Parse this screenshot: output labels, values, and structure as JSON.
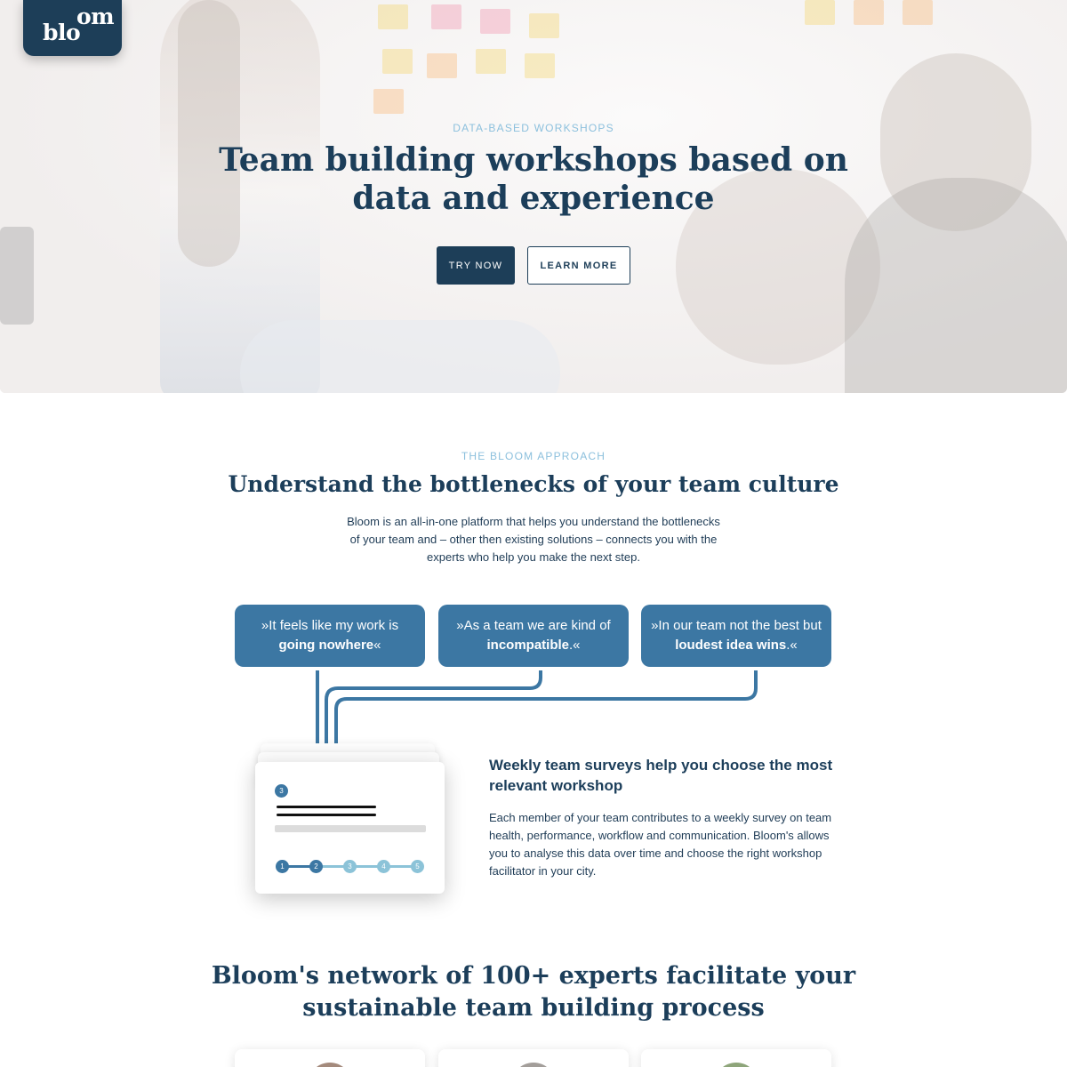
{
  "brand": {
    "logo_top": "om",
    "logo_bottom": "blo"
  },
  "hero": {
    "eyebrow": "DATA-BASED WORKSHOPS",
    "title": "Team building workshops based on data and experience",
    "try_label": "TRY NOW",
    "learn_label": "LEARN MORE"
  },
  "approach": {
    "eyebrow": "THE BLOOM APPROACH",
    "title": "Understand the bottlenecks of your team culture",
    "description": "Bloom is an all-in-one platform that helps you understand the bottlenecks of your team and – other then existing solutions – connects you with the experts who help you make the next step.",
    "quotes": [
      {
        "pre": "»It feels like my work is ",
        "bold": "going nowhere",
        "post": "«"
      },
      {
        "pre": "»As a team we are kind of ",
        "bold": "incompatible",
        "post": ".«"
      },
      {
        "pre": "»In our team not the best but ",
        "bold": "loudest idea wins",
        "post": ".«"
      }
    ],
    "survey_card": {
      "question_number": "3",
      "steps": [
        "1",
        "2",
        "3",
        "4",
        "5"
      ]
    },
    "feature_title": "Weekly team surveys help you choose the most relevant workshop",
    "feature_description": "Each member of your team contributes to a weekly survey on team health, performance, workflow and communication. Bloom's allows you to analyse this data over time and choose the right workshop facilitator in your city."
  },
  "network": {
    "title": "Bloom's network of 100+ experts facilitate your sustainable team building process"
  },
  "colors": {
    "navy": "#1d3e58",
    "accent_blue": "#3c77a3",
    "light_blue": "#8cc0dd"
  }
}
